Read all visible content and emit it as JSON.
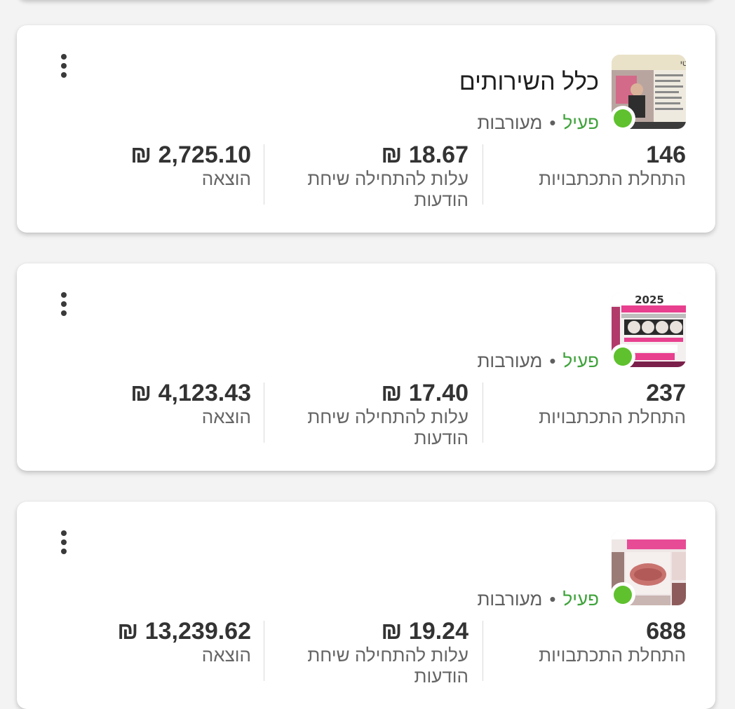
{
  "cards": [
    {
      "title": "כלל השירותים",
      "status": "פעיל",
      "separator": "•",
      "delivery": "מעורבות",
      "metrics": [
        {
          "value": "146",
          "label": "התחלת התכתבויות"
        },
        {
          "value": "18.67 ₪",
          "label": "עלות להתחילה שיחת הודעות"
        },
        {
          "value": "2,725.10 ₪",
          "label": "הוצאה"
        }
      ],
      "thumb": {
        "image_text": "עיסוי לימפטי"
      }
    },
    {
      "title": "",
      "status": "פעיל",
      "separator": "•",
      "delivery": "מעורבות",
      "metrics": [
        {
          "value": "237",
          "label": "התחלת התכתבויות"
        },
        {
          "value": "17.40 ₪",
          "label": "עלות להתחילה שיחת הודעות"
        },
        {
          "value": "4,123.43 ₪",
          "label": "הוצאה"
        }
      ],
      "thumb": {
        "image_text": "2025"
      }
    },
    {
      "title": "",
      "status": "פעיל",
      "separator": "•",
      "delivery": "מעורבות",
      "metrics": [
        {
          "value": "688",
          "label": "התחלת התכתבויות"
        },
        {
          "value": "19.24 ₪",
          "label": "עלות להתחילה שיחת הודעות"
        },
        {
          "value": "13,239.62 ₪",
          "label": "הוצאה"
        }
      ],
      "thumb": {
        "image_text": ""
      }
    }
  ],
  "colors": {
    "active": "#3fa33b",
    "status_dot": "#5fc12e",
    "background": "#f3f3f3",
    "card": "#ffffff"
  },
  "icons": {
    "menu": "more-vertical-icon"
  }
}
